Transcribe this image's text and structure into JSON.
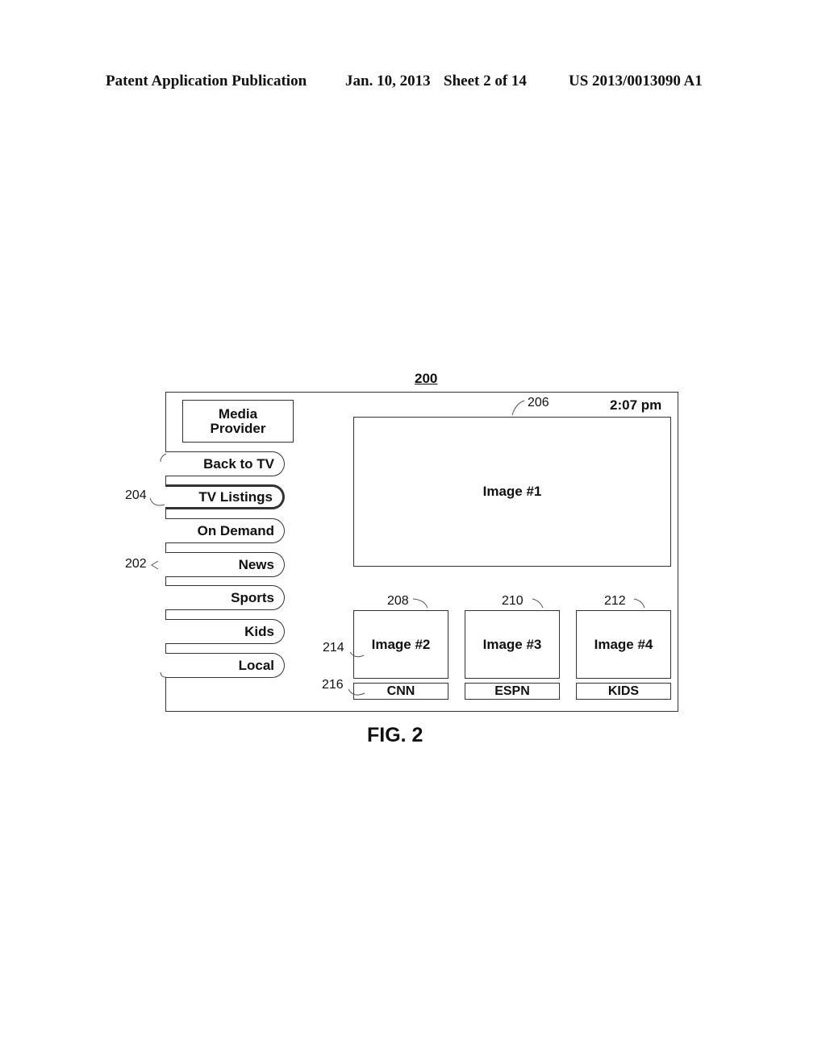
{
  "header": {
    "publication": "Patent Application Publication",
    "date": "Jan. 10, 2013",
    "sheet": "Sheet 2 of 14",
    "patent_number": "US 2013/0013090 A1"
  },
  "figure": {
    "number_label": "200",
    "caption": "FIG. 2"
  },
  "screen": {
    "logo": "Media Provider",
    "clock": "2:07 pm",
    "menu": [
      {
        "label": "Back to TV",
        "selected": false
      },
      {
        "label": "TV Listings",
        "selected": true
      },
      {
        "label": "On Demand",
        "selected": false
      },
      {
        "label": "News",
        "selected": false
      },
      {
        "label": "Sports",
        "selected": false
      },
      {
        "label": "Kids",
        "selected": false
      },
      {
        "label": "Local",
        "selected": false
      }
    ],
    "main_image": "Image #1",
    "thumbnails": [
      {
        "image": "Image #2",
        "channel": "CNN"
      },
      {
        "image": "Image #3",
        "channel": "ESPN"
      },
      {
        "image": "Image #4",
        "channel": "KIDS"
      }
    ]
  },
  "reference_numerals": {
    "menu_group": "202",
    "selected_item": "204",
    "main_image": "206",
    "thumb_1": "208",
    "thumb_2": "210",
    "thumb_3": "212",
    "thumb_image": "214",
    "channel_label": "216"
  }
}
